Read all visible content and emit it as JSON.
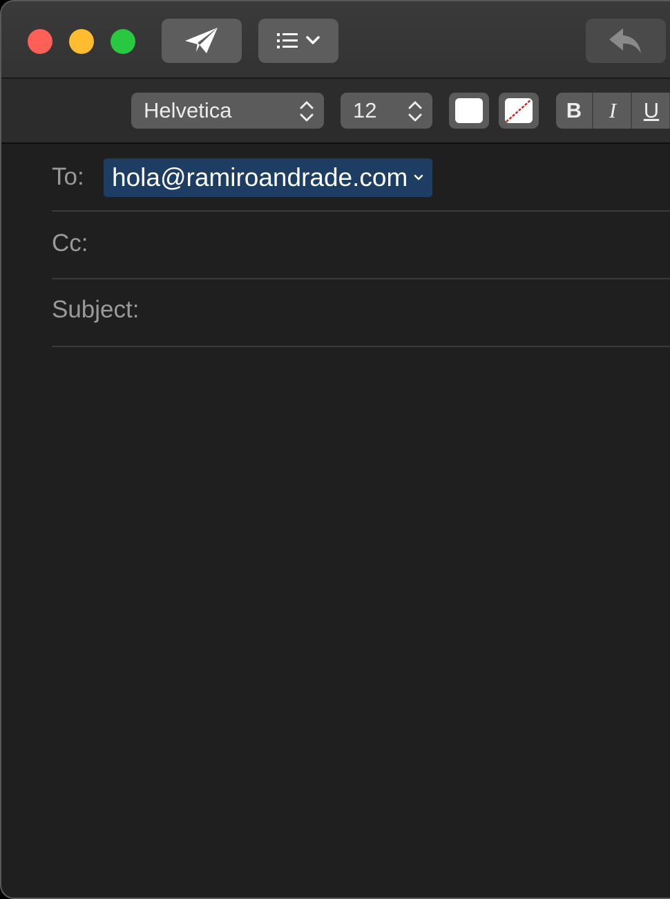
{
  "toolbar": {
    "send_icon": "paper-plane-icon",
    "format_icon": "list-format-icon",
    "reply_icon": "reply-arrow-icon"
  },
  "format_bar": {
    "font_family": "Helvetica",
    "font_size": "12",
    "bold_label": "B",
    "italic_label": "I",
    "underline_label": "U"
  },
  "fields": {
    "to_label": "To:",
    "to_recipient": "hola@ramiroandrade.com",
    "cc_label": "Cc:",
    "subject_label": "Subject:"
  },
  "colors": {
    "close": "#fe5f57",
    "minimize": "#febc2e",
    "zoom": "#28c840",
    "recipient_token": "#1d3d63"
  }
}
